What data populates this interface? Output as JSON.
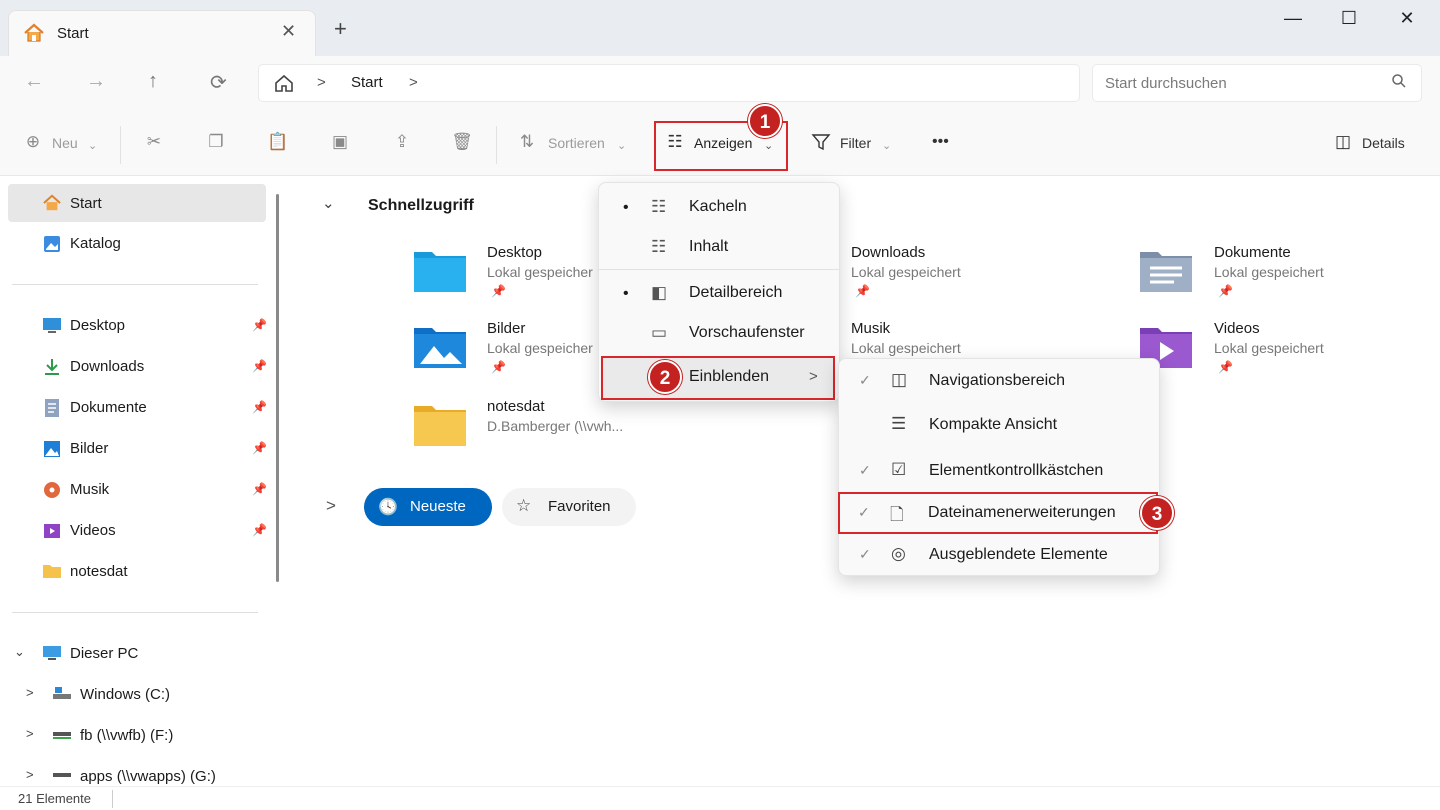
{
  "window": {
    "tab_title": "Start",
    "tab_close": "✕",
    "new_tab": "+",
    "minimize": "—",
    "maximize": "☐",
    "close": "✕"
  },
  "nav": {
    "back": "←",
    "forward": "→",
    "up": "↑",
    "refresh": "⟳",
    "breadcrumb": [
      "Start"
    ],
    "search_placeholder": "Start durchsuchen"
  },
  "toolbar": {
    "new_label": "Neu",
    "sort_label": "Sortieren",
    "view_label": "Anzeigen",
    "filter_label": "Filter",
    "more_label": "•••",
    "details_label": "Details"
  },
  "sidebar": {
    "top": [
      {
        "label": "Start",
        "icon": "home-icon"
      },
      {
        "label": "Katalog",
        "icon": "gallery-icon"
      }
    ],
    "pinned": [
      {
        "label": "Desktop",
        "icon": "desktop-icon"
      },
      {
        "label": "Downloads",
        "icon": "download-icon"
      },
      {
        "label": "Dokumente",
        "icon": "document-icon"
      },
      {
        "label": "Bilder",
        "icon": "pictures-icon"
      },
      {
        "label": "Musik",
        "icon": "music-icon"
      },
      {
        "label": "Videos",
        "icon": "video-icon"
      },
      {
        "label": "notesdat",
        "icon": "folder-icon"
      }
    ],
    "this_pc": "Dieser PC",
    "drives": [
      {
        "label": "Windows (C:)"
      },
      {
        "label": "fb (\\\\vwfb) (F:)"
      },
      {
        "label": "apps (\\\\vwapps) (G:)"
      }
    ]
  },
  "content": {
    "section_title": "Schnellzugriff",
    "items": [
      {
        "name": "Desktop",
        "sub": "Lokal gespeicher"
      },
      {
        "name": "Downloads",
        "sub": "Lokal gespeichert"
      },
      {
        "name": "Dokumente",
        "sub": "Lokal gespeichert"
      },
      {
        "name": "Bilder",
        "sub": "Lokal gespeicher"
      },
      {
        "name": "Musik",
        "sub": "Lokal gespeichert"
      },
      {
        "name": "Videos",
        "sub": "Lokal gespeichert"
      },
      {
        "name": "notesdat",
        "sub": "D.Bamberger (\\\\vwh..."
      }
    ],
    "recent_label": "Neueste",
    "favorites_label": "Favoriten"
  },
  "view_menu": {
    "items": [
      {
        "label": "Kacheln",
        "bullet": "•"
      },
      {
        "label": "Inhalt",
        "bullet": ""
      },
      {
        "label": "Detailbereich",
        "bullet": "•"
      },
      {
        "label": "Vorschaufenster",
        "bullet": ""
      },
      {
        "label": "Einblenden",
        "bullet": ""
      }
    ]
  },
  "show_submenu": {
    "items": [
      {
        "label": "Navigationsbereich",
        "checked": "✓"
      },
      {
        "label": "Kompakte Ansicht",
        "checked": ""
      },
      {
        "label": "Elementkontrollkästchen",
        "checked": "✓"
      },
      {
        "label": "Dateinamenerweiterungen",
        "checked": "✓"
      },
      {
        "label": "Ausgeblendete Elemente",
        "checked": "✓"
      }
    ]
  },
  "badges": [
    "1",
    "2",
    "3"
  ],
  "status": {
    "count": "21 Elemente"
  },
  "colors": {
    "accent": "#0067c0",
    "highlight": "#d9262b",
    "badge": "#c42121"
  }
}
